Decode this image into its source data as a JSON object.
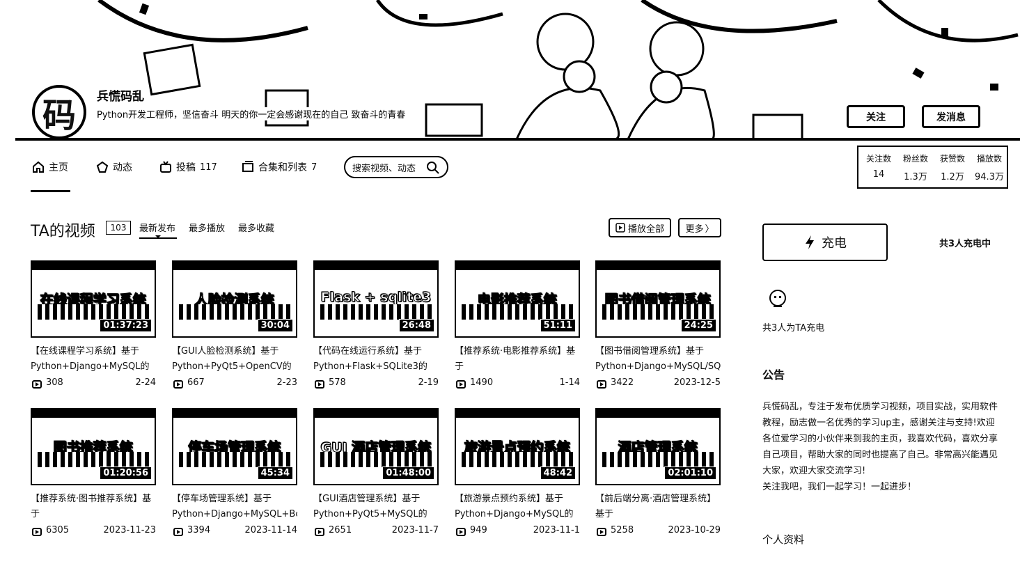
{
  "profile": {
    "avatar_char": "码",
    "name": "兵慌码乱",
    "sign": "Python开发工程师，坚信奋斗 明天的你一定会感谢现在的自己 致奋斗的青春",
    "follow_label": "关注",
    "message_label": "发消息"
  },
  "nav": {
    "home": "主页",
    "dynamic": "动态",
    "posts": "投稿",
    "posts_count": "117",
    "collections": "合集和列表",
    "collections_count": "7",
    "search_placeholder": "搜索视频、动态"
  },
  "stats": [
    {
      "label": "关注数",
      "value": "14"
    },
    {
      "label": "粉丝数",
      "value": "1.3万"
    },
    {
      "label": "获赞数",
      "value": "1.2万"
    },
    {
      "label": "播放数",
      "value": "94.3万"
    }
  ],
  "videos_section": {
    "title": "TA的视频",
    "count": "103",
    "tabs": [
      "最新发布",
      "最多播放",
      "最多收藏"
    ],
    "play_all": "播放全部",
    "more": "更多"
  },
  "videos": [
    {
      "thumb_title": "在线课程学习系统",
      "duration": "01:37:23",
      "title": "【在线课程学习系统】基于Python+Django+MySQL的",
      "views": "308",
      "date": "2-24"
    },
    {
      "thumb_title": "人脸检测系统",
      "duration": "30:04",
      "title": "【GUI人脸检测系统】基于Python+PyQt5+OpenCV的",
      "views": "667",
      "date": "2-23"
    },
    {
      "thumb_title": "Flask + sqlite3",
      "duration": "26:48",
      "title": "【代码在线运行系统】基于Python+Flask+SQLite3的",
      "views": "578",
      "date": "2-19"
    },
    {
      "thumb_title": "电影推荐系统",
      "duration": "51:11",
      "title": "【推荐系统·电影推荐系统】基于",
      "views": "1490",
      "date": "1-14"
    },
    {
      "thumb_title": "图书借阅管理系统",
      "duration": "24:25",
      "title": "【图书借阅管理系统】基于Python+Django+MySQL/SQ",
      "views": "3422",
      "date": "2023-12-5"
    },
    {
      "thumb_title": "图书推荐系统",
      "duration": "01:20:56",
      "title": "【推荐系统·图书推荐系统】基于",
      "views": "6305",
      "date": "2023-11-23"
    },
    {
      "thumb_title": "停车场管理系统",
      "duration": "45:34",
      "title": "【停车场管理系统】基于Python+Django+MySQL+Bo",
      "views": "3394",
      "date": "2023-11-14"
    },
    {
      "thumb_title": "GUI 酒店管理系统",
      "duration": "01:48:00",
      "title": "【GUI酒店管理系统】基于Python+PyQt5+MySQL的",
      "views": "2651",
      "date": "2023-11-7"
    },
    {
      "thumb_title": "旅游景点预约系统",
      "duration": "48:42",
      "title": "【旅游景点预约系统】基于Python+Django+MySQL的",
      "views": "949",
      "date": "2023-11-1"
    },
    {
      "thumb_title": "酒店管理系统",
      "duration": "02:01:10",
      "title": "【前后端分离·酒店管理系统】基于",
      "views": "5258",
      "date": "2023-10-29"
    }
  ],
  "sidebar": {
    "charge_label": "充电",
    "charge_info": "共3人充电中",
    "charger_text": "共3人为TA充电",
    "notice_title": "公告",
    "notice_text": "兵慌码乱，专注于发布优质学习视频，项目实战，实用软件教程，励志做一名优秀的学习up主，感谢关注与支持!欢迎各位爱学习的小伙伴来到我的主页，我喜欢代码，喜欢分享自己项目，帮助大家的同时也提高了自己。非常高兴能遇见大家，欢迎大家交流学习!",
    "notice_text2": "关注我吧，我们一起学习！一起进步！",
    "profile_title": "个人资料"
  }
}
